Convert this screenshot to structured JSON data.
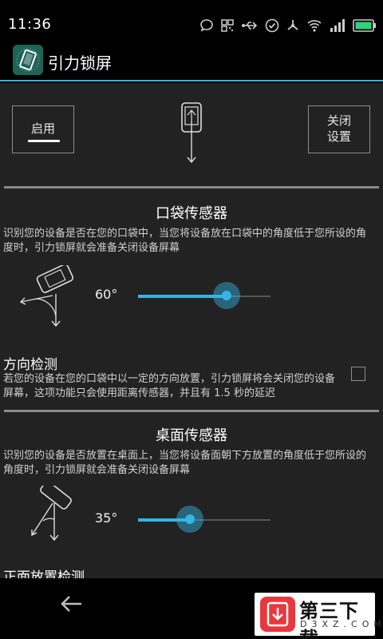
{
  "status_bar": {
    "time": "11:36",
    "icons": [
      "chat-bubble-icon",
      "qr-code-icon",
      "usb-icon",
      "check-circle-icon",
      "tethering-icon",
      "wifi-icon",
      "signal-icon",
      "battery-icon"
    ],
    "battery_color": "#33d17a"
  },
  "action_bar": {
    "title": "引力锁屏",
    "accent": "#33b5e5"
  },
  "controls": {
    "enable_label": "启用",
    "close_settings_label_line1": "关闭",
    "close_settings_label_line2": "设置"
  },
  "pocket_sensor": {
    "title": "口袋传感器",
    "description": "识别您的设备是否在您的口袋中，当您将设备放在口袋中的角度低于您所设的角度时，引力锁屏就会准备关闭设备屏幕",
    "angle_label": "60°",
    "slider_fraction": 0.67
  },
  "orientation_check": {
    "title": "方向检测",
    "description": "若您的设备在您的口袋中以一定的方向放置，引力锁屏将会关闭您的设备屏幕，这项功能只会使用距离传感器，并且有 1.5 秒的延迟",
    "checked": false
  },
  "table_sensor": {
    "title": "桌面传感器",
    "description": "识别您的设备是否放置在桌面上，当您将设备面朝下方放置的角度低于您所设的角度时，引力锁屏就会准备关闭设备屏幕",
    "angle_label": "35°",
    "slider_fraction": 0.39
  },
  "face_up_check": {
    "title": "正面放置检测"
  },
  "nav_bar": {
    "back_icon": "back-arrow-icon"
  },
  "watermark": {
    "text": "第三下载",
    "sub": "D3XZ.COM"
  }
}
